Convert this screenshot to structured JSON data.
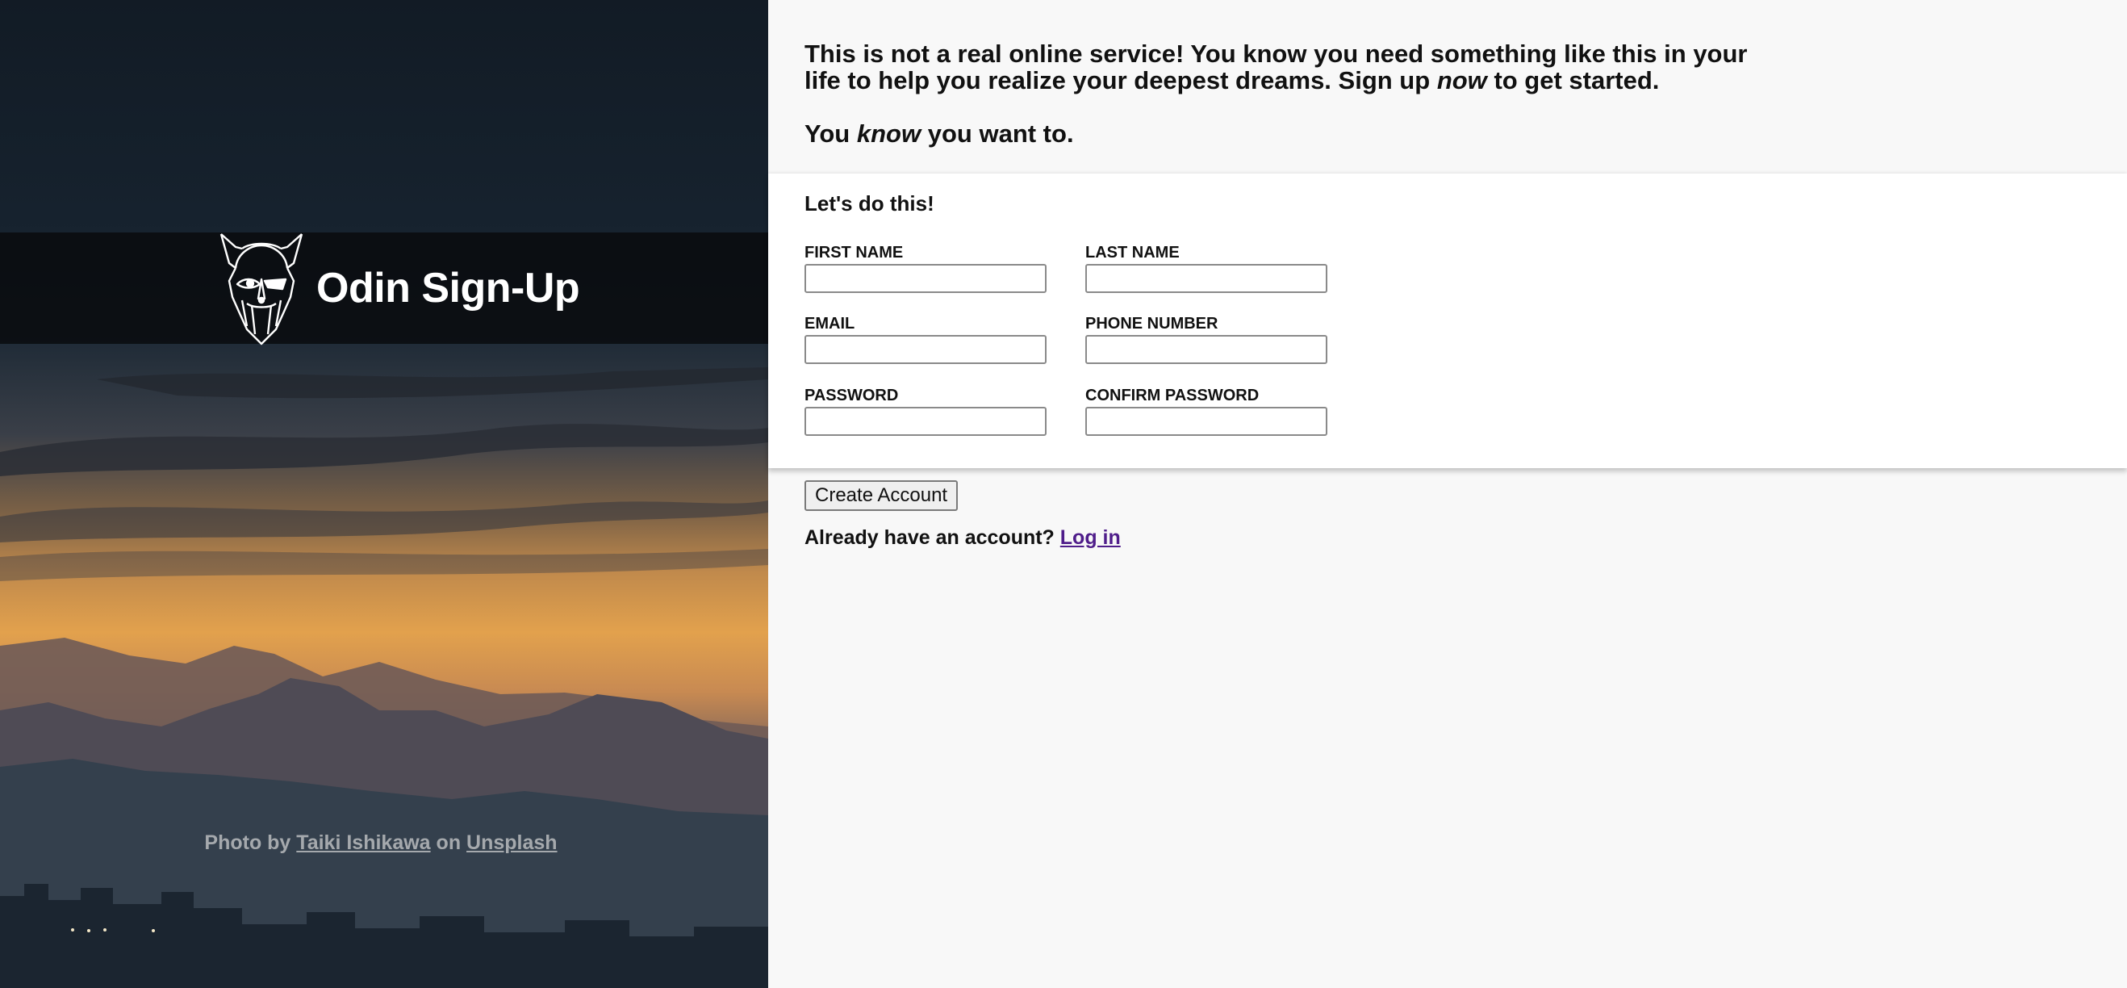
{
  "brand": {
    "title": "Odin Sign-Up",
    "logo_icon": "odin-viking-helmet-icon"
  },
  "hero": {
    "credit_prefix": "Photo by",
    "photographer": "Taiki Ishikawa",
    "credit_middle": "on",
    "source": "Unsplash"
  },
  "intro": {
    "line1_start": "This is not a real online service! You know you need something like this in your life to help you realize your deepest dreams. Sign up",
    "line1_em": "now",
    "line1_end": "to get started.",
    "line2_start": "You",
    "line2_em": "know",
    "line2_end": "you want to."
  },
  "form": {
    "heading": "Let's do this!",
    "fields": {
      "first_name": {
        "label": "FIRST NAME",
        "value": ""
      },
      "last_name": {
        "label": "LAST NAME",
        "value": ""
      },
      "email": {
        "label": "EMAIL",
        "value": ""
      },
      "phone": {
        "label": "PHONE NUMBER",
        "value": ""
      },
      "password": {
        "label": "PASSWORD",
        "value": ""
      },
      "confirm_password": {
        "label": "CONFIRM PASSWORD",
        "value": ""
      }
    }
  },
  "actions": {
    "create_account_label": "Create Account",
    "login_prompt": "Already have an account?",
    "login_link": "Log in"
  },
  "colors": {
    "link_visited": "#4f1d8a",
    "hero_band": "#080a0c",
    "card_bg": "#ffffff",
    "page_bg": "#f8f8f8"
  }
}
